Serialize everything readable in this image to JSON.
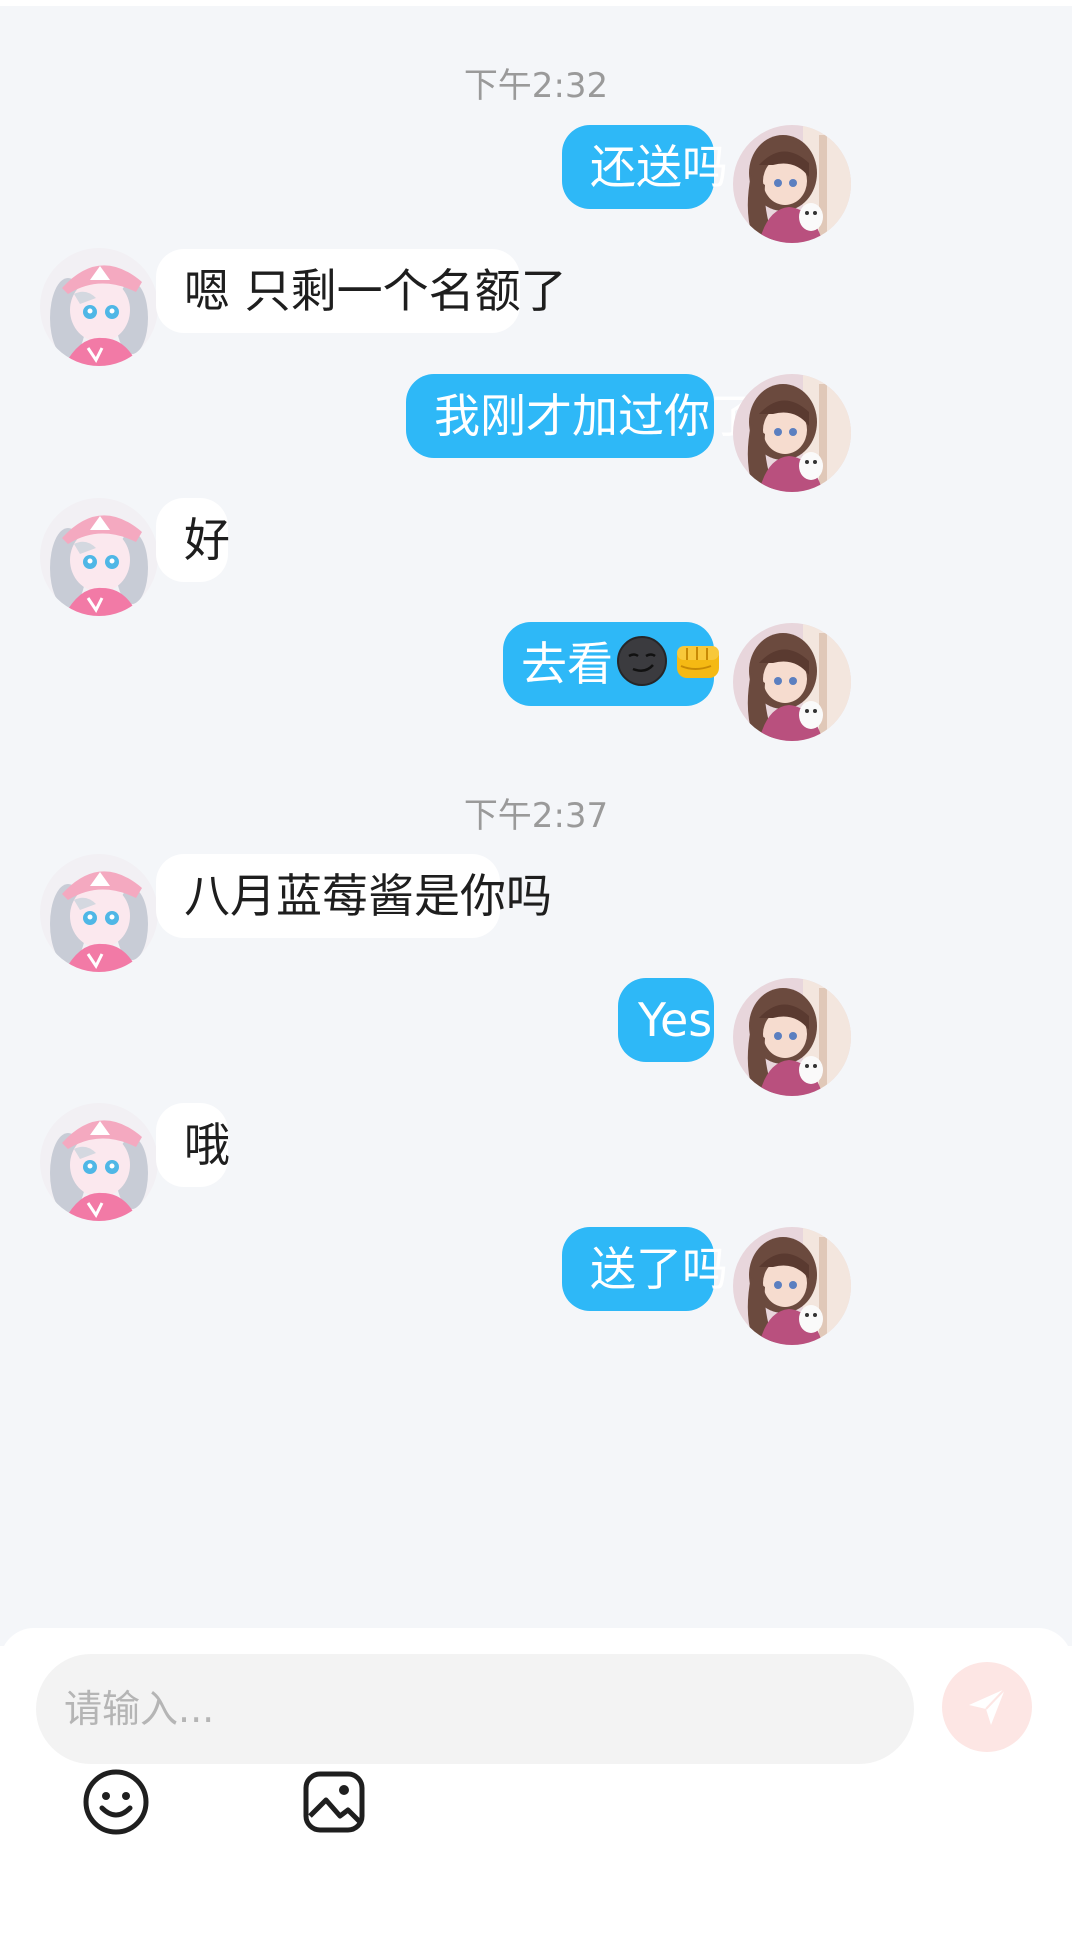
{
  "chat": {
    "timestamps": [
      "下午2:32",
      "下午2:37"
    ],
    "messages": [
      {
        "side": "sent",
        "text": "还送吗"
      },
      {
        "side": "received",
        "text": "嗯 只剩一个名额了"
      },
      {
        "side": "sent",
        "text": "我刚才加过你了"
      },
      {
        "side": "received",
        "text": "好"
      },
      {
        "side": "sent",
        "text": "去看",
        "emojis": [
          "smirk-face-emoji",
          "fist-bump-emoji"
        ]
      },
      {
        "side": "received",
        "text": "八月蓝莓酱是你吗"
      },
      {
        "side": "sent",
        "text": "Yes"
      },
      {
        "side": "received",
        "text": "哦"
      },
      {
        "side": "sent",
        "text": "送了吗"
      }
    ]
  },
  "input": {
    "placeholder": "请输入..."
  },
  "toolbar": {
    "icons": [
      "smiley-icon",
      "image-icon",
      "send-icon"
    ]
  },
  "colors": {
    "sent_bubble": "#2eb8f7",
    "received_bubble": "#ffffff",
    "chat_background": "#f4f6f9",
    "send_button": "#fde6e4"
  }
}
